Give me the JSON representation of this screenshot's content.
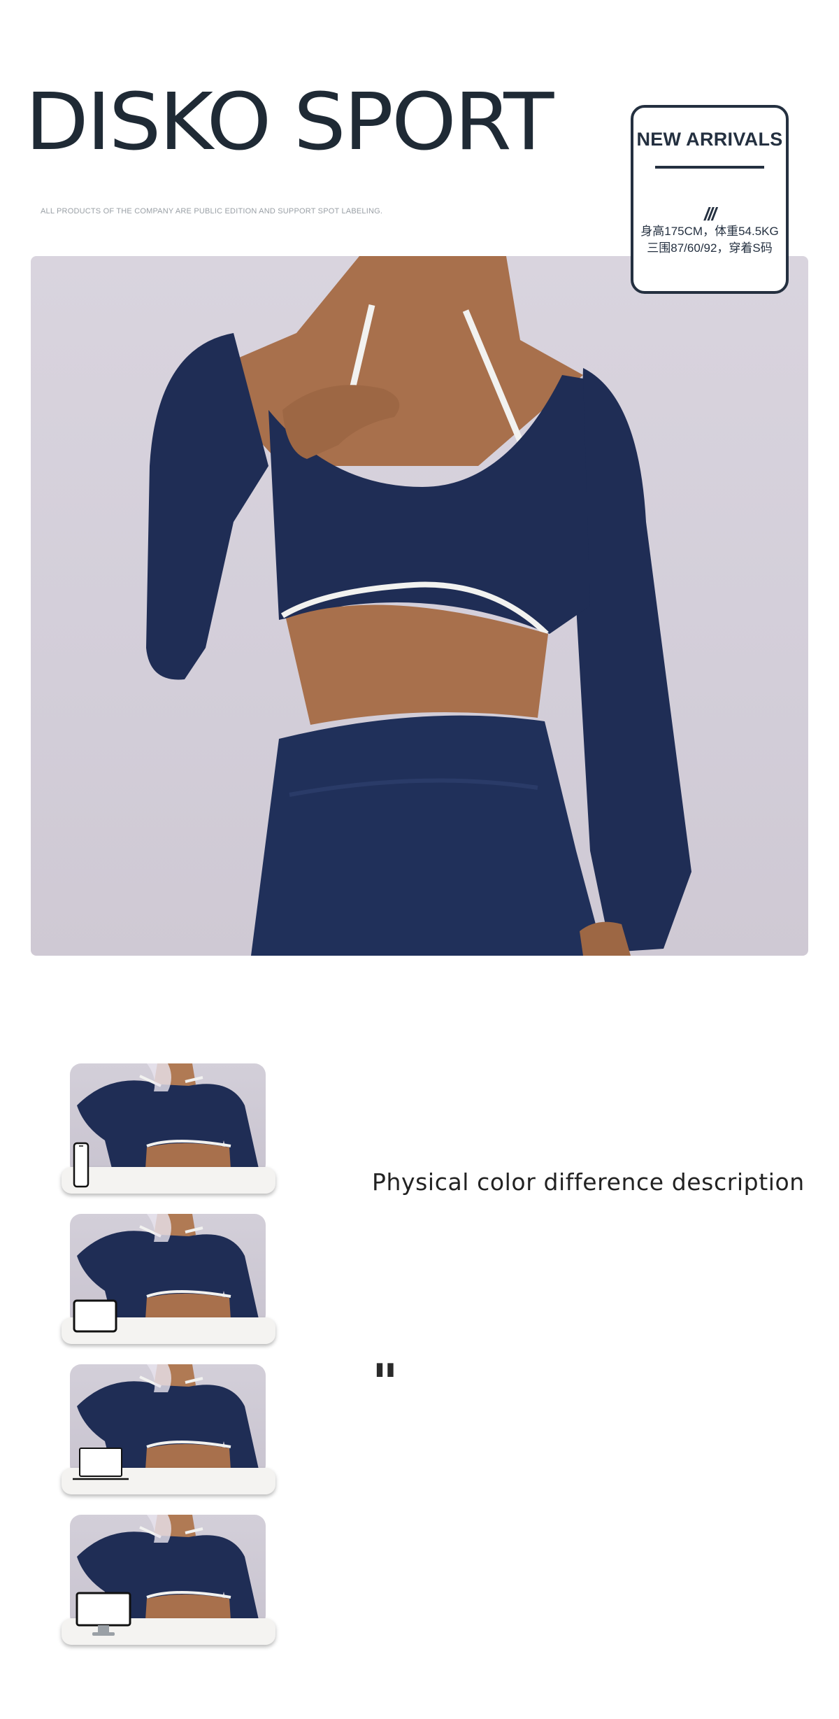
{
  "header": {
    "brand": "DISKO SPORT",
    "disclaimer": "ALL PRODUCTS OF THE COMPANY ARE PUBLIC EDITION AND SUPPORT SPOT LABELING."
  },
  "badge": {
    "title": "NEW ARRIVALS",
    "slashes": "///",
    "line1": "身高175CM，体重54.5KG",
    "line2": "三围87/60/92，穿着S码"
  },
  "thumbnails": [
    {
      "device": "phone-icon"
    },
    {
      "device": "tablet-icon"
    },
    {
      "device": "laptop-icon"
    },
    {
      "device": "monitor-icon"
    }
  ],
  "description": {
    "title": "Physical color difference description",
    "quote": "\""
  },
  "colors": {
    "brand_text": "#1f2a35",
    "garment_navy": "#1f2d55",
    "trim_white": "#f2f2f0",
    "backdrop": "#d6d1dc",
    "skin": "#a8704c"
  }
}
